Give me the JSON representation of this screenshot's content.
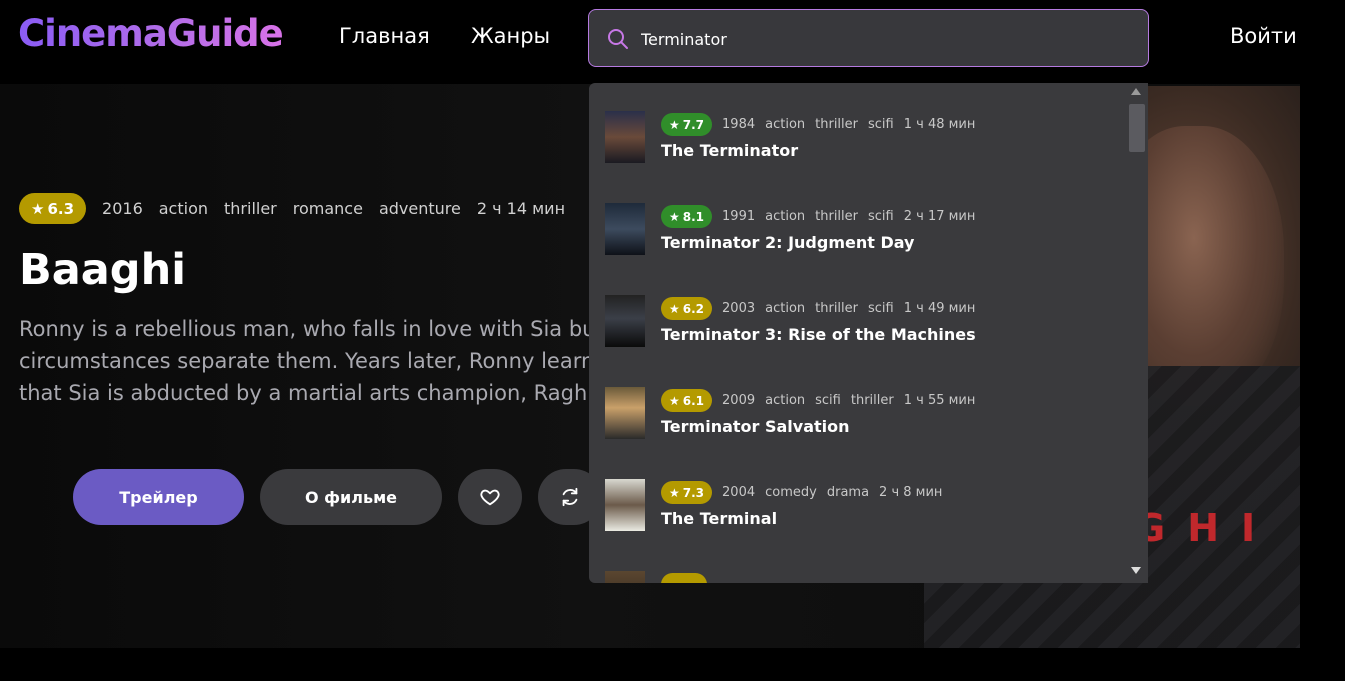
{
  "header": {
    "logo": "CinemaGuide",
    "nav": {
      "home": "Главная",
      "genres": "Жанры"
    },
    "login": "Войти",
    "search": {
      "value": "Terminator",
      "placeholder": "",
      "icon": "search-icon"
    }
  },
  "colors": {
    "accent": "#6b5bc4",
    "search_border": "#b57ae0",
    "rating_yellow": "#b49a00",
    "rating_green": "#308e2a"
  },
  "hero": {
    "rating": "6.3",
    "year": "2016",
    "genres": [
      "action",
      "thriller",
      "romance",
      "adventure"
    ],
    "duration": "2 ч 14 мин",
    "title": "Baaghi",
    "description": "Ronny is a rebellious man, who falls in love with Sia but circumstances separate them. Years later, Ronny learns that Sia is abducted by a martial arts champion, Ragh",
    "buttons": {
      "trailer": "Трейлер",
      "about": "О фильме"
    },
    "poster_text": "GHI"
  },
  "search_results": [
    {
      "rating": "7.7",
      "rating_color": "green",
      "year": "1984",
      "genres": [
        "action",
        "thriller",
        "scifi"
      ],
      "duration": "1 ч 48 мин",
      "title": "The Terminator"
    },
    {
      "rating": "8.1",
      "rating_color": "green",
      "year": "1991",
      "genres": [
        "action",
        "thriller",
        "scifi"
      ],
      "duration": "2 ч 17 мин",
      "title": "Terminator 2: Judgment Day"
    },
    {
      "rating": "6.2",
      "rating_color": "yellow",
      "year": "2003",
      "genres": [
        "action",
        "thriller",
        "scifi"
      ],
      "duration": "1 ч 49 мин",
      "title": "Terminator 3: Rise of the Machines"
    },
    {
      "rating": "6.1",
      "rating_color": "yellow",
      "year": "2009",
      "genres": [
        "action",
        "scifi",
        "thriller"
      ],
      "duration": "1 ч 55 мин",
      "title": "Terminator Salvation"
    },
    {
      "rating": "7.3",
      "rating_color": "yellow",
      "year": "2004",
      "genres": [
        "comedy",
        "drama"
      ],
      "duration": "2 ч 8 мин",
      "title": "The Terminal"
    }
  ]
}
